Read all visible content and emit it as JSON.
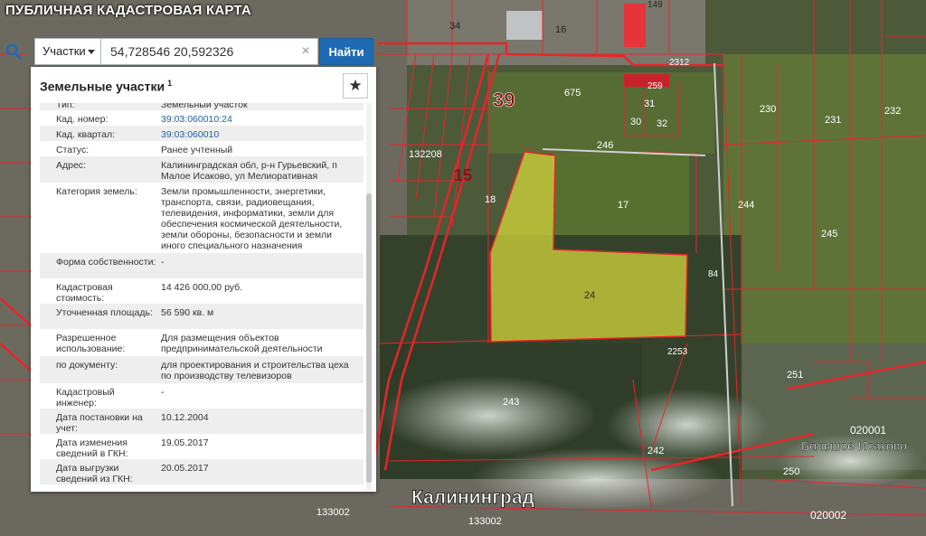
{
  "app": {
    "title": "ПУБЛИЧНАЯ КАДАСТРОВАЯ КАРТА"
  },
  "search": {
    "type_label": "Участки",
    "query": "54,728546 20,592326",
    "clear": "×",
    "find_label": "Найти"
  },
  "panel": {
    "title": "Земельные участки",
    "count": "1",
    "rows": [
      {
        "label": "Тип:",
        "value": "Земельный участок",
        "link": false
      },
      {
        "label": "Кад. номер:",
        "value": "39:03:060010:24",
        "link": true
      },
      {
        "label": "Кад. квартал:",
        "value": "39:03:060010",
        "link": true
      },
      {
        "label": "Статус:",
        "value": "Ранее учтенный",
        "link": false
      },
      {
        "label": "Адрес:",
        "value": "Калининградская обл, р-н Гурьевский, п Малое Исаково, ул Мелиоративная",
        "link": false
      },
      {
        "label": "Категория земель:",
        "value": "Земли промышленности, энергетики, транспорта, связи, радиовещания, телевидения, информатики, земли для обеспечения космической деятельности, земли обороны, безопасности и земли иного специального назначения",
        "link": false
      },
      {
        "label": "Форма собственности:",
        "value": "-",
        "link": false
      },
      {
        "label": "Кадастровая стоимость:",
        "value": "14 426 000,00 руб.",
        "link": false
      },
      {
        "label": "Уточненная площадь:",
        "value": "56 590 кв. м",
        "link": false
      },
      {
        "label": "Разрешенное использование:",
        "value": "Для размещения объектов предпринимательской деятельности",
        "link": false
      },
      {
        "label": "по документу:",
        "value": "для проектирования и строительства цеха по производству телевизоров",
        "link": false
      },
      {
        "label": "Кадастровый инженер:",
        "value": "-",
        "link": false
      },
      {
        "label": "Дата постановки на учет:",
        "value": "10.12.2004",
        "link": false
      },
      {
        "label": "Дата изменения сведений в ГКН:",
        "value": "19.05.2017",
        "link": false
      },
      {
        "label": "Дата выгрузки сведений из ГКН:",
        "value": "20.05.2017",
        "link": false
      }
    ]
  },
  "map": {
    "labels": {
      "city": "Калининград",
      "village": "Большое Исаково",
      "road": "39",
      "road2": "15",
      "selected": "24",
      "parcel_17": "17",
      "parcel_18": "18",
      "parcel_246": "246",
      "parcel_675": "675",
      "parcel_259": "259",
      "parcel_31": "31",
      "parcel_30": "30",
      "parcel_32": "32",
      "parcel_230": "230",
      "parcel_231": "231",
      "parcel_244": "244",
      "parcel_245": "245",
      "parcel_243": "243",
      "parcel_2253": "2253",
      "parcel_242": "242",
      "parcel_251": "251",
      "parcel_250": "250",
      "parcel_2312": "2312",
      "parcel_34": "34",
      "parcel_16": "16",
      "parcel_149": "149",
      "quarter_132208": "132208",
      "quarter_020001": "020001",
      "quarter_020002": "020002",
      "quarter_133002a": "133002",
      "quarter_133002b": "133002",
      "parcel_232": "232",
      "parcel_84": "84"
    },
    "colors": {
      "boundary": "#e8242b",
      "selected_fill": "#d9dc3a",
      "field": "#5b7036",
      "forest": "#33402a"
    }
  }
}
